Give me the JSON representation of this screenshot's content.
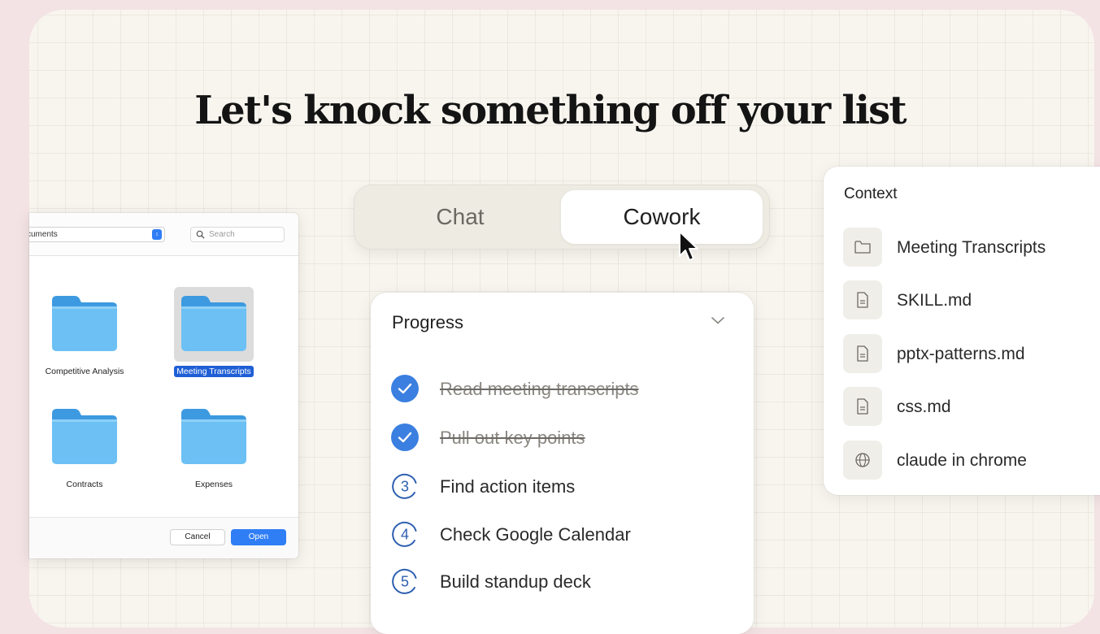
{
  "headline": "Let's knock something off your list",
  "file_dialog": {
    "location_label": "cuments",
    "search_placeholder": "Search",
    "folders": [
      {
        "label": "Competitive Analysis",
        "selected": false
      },
      {
        "label": "Meeting Transcripts",
        "selected": true
      },
      {
        "label": "Contracts",
        "selected": false
      },
      {
        "label": "Expenses",
        "selected": false
      }
    ],
    "cancel_label": "Cancel",
    "open_label": "Open"
  },
  "mode_toggle": {
    "tabs": [
      {
        "label": "Chat",
        "active": false
      },
      {
        "label": "Cowork",
        "active": true
      }
    ]
  },
  "progress": {
    "title": "Progress",
    "steps": [
      {
        "number": "1",
        "label": "Read meeting transcripts",
        "done": true
      },
      {
        "number": "2",
        "label": "Pull out key points",
        "done": true
      },
      {
        "number": "3",
        "label": "Find action items",
        "done": false
      },
      {
        "number": "4",
        "label": "Check Google Calendar",
        "done": false
      },
      {
        "number": "5",
        "label": "Build standup deck",
        "done": false
      }
    ]
  },
  "context": {
    "title": "Context",
    "items": [
      {
        "icon": "folder-icon",
        "label": "Meeting Transcripts"
      },
      {
        "icon": "document-icon",
        "label": "SKILL.md"
      },
      {
        "icon": "document-icon",
        "label": "pptx-patterns.md"
      },
      {
        "icon": "document-icon",
        "label": "css.md"
      },
      {
        "icon": "globe-icon",
        "label": "claude in chrome"
      }
    ]
  },
  "colors": {
    "page_background": "#f3e3e4",
    "canvas_background": "#f8f5ef",
    "accent_blue": "#2f7ef5",
    "step_done_blue": "#3b7fe0"
  }
}
